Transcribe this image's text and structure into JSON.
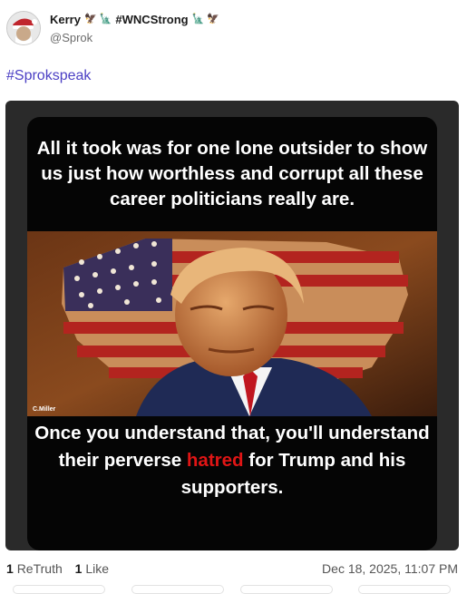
{
  "author": {
    "display_name": "Kerry",
    "name_tag": "#WNCStrong",
    "handle": "@Sprok",
    "emoji_left": "🦅 🗽",
    "emoji_right": "🗽 🦅"
  },
  "post": {
    "hashtag": "#Sprokspeak"
  },
  "meme": {
    "top_text": "All it took was for one lone outsider to show us just how worthless and corrupt all these career politicians really are.",
    "credit": "C.Miller",
    "bottom_before": "Once you understand that, you'll understand their perverse ",
    "bottom_highlight": "hatred",
    "bottom_after": " for Trump and his supporters.",
    "highlight_color": "#e01515"
  },
  "stats": {
    "retruth_count": "1",
    "retruth_label": "ReTruth",
    "like_count": "1",
    "like_label": "Like",
    "timestamp": "Dec 18, 2025, 11:07 PM"
  },
  "colors": {
    "hashtag": "#4b3fc4",
    "media_bg": "#2a2a2a"
  }
}
